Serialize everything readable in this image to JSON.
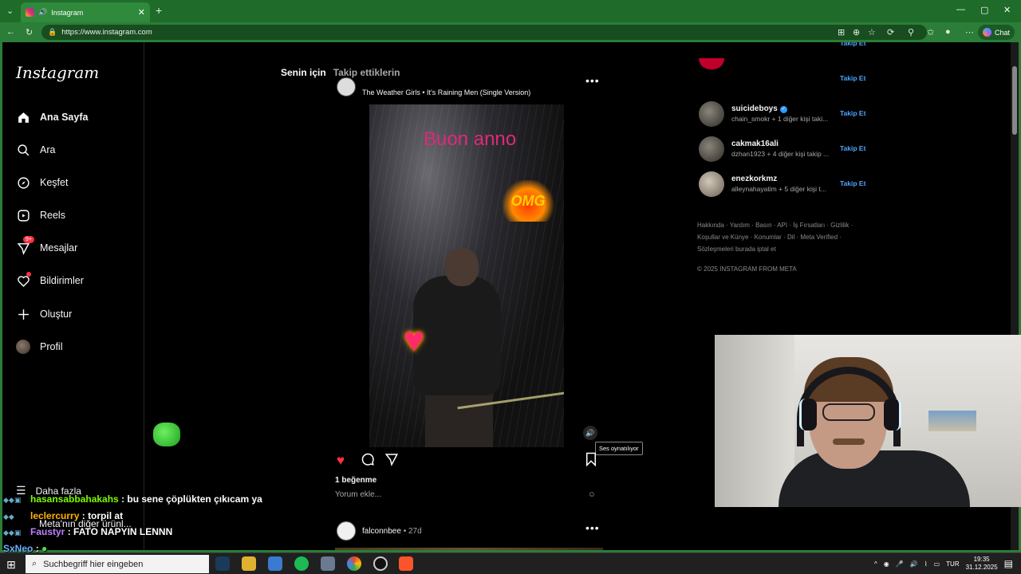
{
  "browser": {
    "tab_title": "Instagram",
    "url": "https://www.instagram.com",
    "chat_label": "Chat"
  },
  "sidebar": {
    "logo": "Instagram",
    "items": [
      {
        "label": "Ana Sayfa",
        "icon": "home-icon"
      },
      {
        "label": "Ara",
        "icon": "search-icon"
      },
      {
        "label": "Keşfet",
        "icon": "compass-icon"
      },
      {
        "label": "Reels",
        "icon": "reels-icon"
      },
      {
        "label": "Mesajlar",
        "icon": "messages-icon",
        "badge": "9+"
      },
      {
        "label": "Bildirimler",
        "icon": "heart-icon"
      },
      {
        "label": "Oluştur",
        "icon": "plus-icon"
      },
      {
        "label": "Profil",
        "icon": "avatar"
      }
    ],
    "more": "Daha fazla",
    "meta_more": "Meta'nın diğer ürünl..."
  },
  "feed": {
    "tabs": [
      "Senin için",
      "Takip ettiklerin"
    ],
    "post": {
      "audio": "The Weather Girls • It's Raining Men (Single Version)",
      "overlay_text": "Buon anno",
      "sticker_text": "OMG",
      "tooltip": "Ses oynatılıyor",
      "likes": "1 beğenme",
      "comment_placeholder": "Yorum ekle..."
    },
    "next_post": {
      "username": "falconnbee",
      "time": "• 27d"
    }
  },
  "suggestions": {
    "follow_label": "Takip Et",
    "items": [
      {
        "username": "suicideboys",
        "verified": true,
        "sub": "chain_smokr + 1 diğer kişi taki..."
      },
      {
        "username": "cakmak16ali",
        "verified": false,
        "sub": "dzhan1923 + 4 diğer kişi takip ..."
      },
      {
        "username": "enezkorkmz",
        "verified": false,
        "sub": "alleynahayatim + 5 diğer kişi t..."
      }
    ]
  },
  "footer": {
    "links": "Hakkında · Yardım · Basın · API · İş Fırsatları · Gizlilik · Koşullar ve Künye · Konumlar · Dil · Meta Verified · Sözleşmeleri burada iptal et",
    "copyright": "© 2025 INSTAGRAM FROM META"
  },
  "chat": [
    {
      "user": "hasansabbahakahs",
      "color": "#7cfc00",
      "message": ": bu sene çöplükten çıkıcam ya"
    },
    {
      "user": "leclercurry",
      "color": "#ffb400",
      "message": ": torpil at"
    },
    {
      "user": "Faustyr",
      "color": "#c080ff",
      "message": ": FATO NAPYIN LENNN"
    },
    {
      "user": "SxNeo",
      "color": "#6ab0ff",
      "message": ":"
    }
  ],
  "taskbar": {
    "search_placeholder": "Suchbegriff hier eingeben",
    "language": "TUR",
    "time": "19:35",
    "date": "31.12.2025"
  }
}
